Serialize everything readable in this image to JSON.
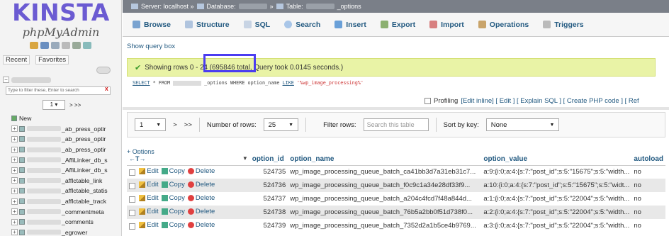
{
  "sidebar": {
    "logo": "KINSTA",
    "product": "phpMyAdmin",
    "tab_recent": "Recent",
    "tab_favorites": "Favorites",
    "filter_placeholder": "Type to filter these, Enter to search",
    "filter_clear": "X",
    "page_select": "1",
    "page_nav": "> >>",
    "new_label": "New",
    "tables": [
      "_ab_press_optir",
      "_ab_press_optir",
      "_ab_press_optir",
      "_AffiLinker_db_s",
      "_AffiLinker_db_s",
      "_afflctable_link",
      "_afflctable_statis",
      "_afflctable_track",
      "_commentmeta",
      "_comments",
      "_egrower"
    ]
  },
  "breadcrumb": {
    "server": "Server: localhost »",
    "database": "Database:",
    "table_sep": "»",
    "table": "Table:",
    "table_name": "_options"
  },
  "tabs": [
    "Browse",
    "Structure",
    "SQL",
    "Search",
    "Insert",
    "Export",
    "Import",
    "Operations",
    "Triggers"
  ],
  "show_query_box": "Show query box",
  "success_message": "Showing rows 0 - 24 (695846 total, Query took 0.0145 seconds.)",
  "sql": {
    "select": "SELECT",
    "star_from": "* FROM",
    "rest": "_options WHERE option_name",
    "like": "LIKE",
    "pattern": "'%wp_image_processing%'"
  },
  "profiling": {
    "label": "Profiling",
    "links": "[Edit inline] [ Edit ] [ Explain SQL ] [ Create PHP code ] [ Ref"
  },
  "nav": {
    "page": "1",
    "next": ">",
    "last": ">>",
    "rows_label": "Number of rows:",
    "rows_value": "25",
    "filter_label": "Filter rows:",
    "filter_placeholder": "Search this table",
    "sort_label": "Sort by key:",
    "sort_value": "None"
  },
  "plus_options": "+ Options",
  "columns": {
    "arrows": "←T→",
    "option_id": "option_id",
    "option_name": "option_name",
    "option_value": "option_value",
    "autoload": "autoload"
  },
  "actions": {
    "edit": "Edit",
    "copy": "Copy",
    "delete": "Delete"
  },
  "rows": [
    {
      "option_id": "524735",
      "option_name": "wp_image_processing_queue_batch_ca41bb3d7a31eb31c7...",
      "option_value": "a:9:{i:0;a:4:{s:7:\"post_id\";s:5:\"15675\";s:5:\"width...",
      "autoload": "no"
    },
    {
      "option_id": "524736",
      "option_name": "wp_image_processing_queue_batch_f0c9c1a34e28df33f9...",
      "option_value": "a:10:{i:0;a:4:{s:7:\"post_id\";s:5:\"15675\";s:5:\"widt...",
      "autoload": "no"
    },
    {
      "option_id": "524737",
      "option_name": "wp_image_processing_queue_batch_a204c4fcd7f48a844d...",
      "option_value": "a:1:{i:0;a:4:{s:7:\"post_id\";s:5:\"22004\";s:5:\"width...",
      "autoload": "no"
    },
    {
      "option_id": "524738",
      "option_name": "wp_image_processing_queue_batch_76b5a2bb0f51d738f0...",
      "option_value": "a:2:{i:0;a:4:{s:7:\"post_id\";s:5:\"22004\";s:5:\"width...",
      "autoload": "no"
    },
    {
      "option_id": "524739",
      "option_name": "wp_image_processing_queue_batch_7352d2a1b5ce4b9769...",
      "option_value": "a:3:{i:0;a:4:{s:7:\"post_id\";s:5:\"22004\";s:5:\"width...",
      "autoload": "no"
    }
  ]
}
